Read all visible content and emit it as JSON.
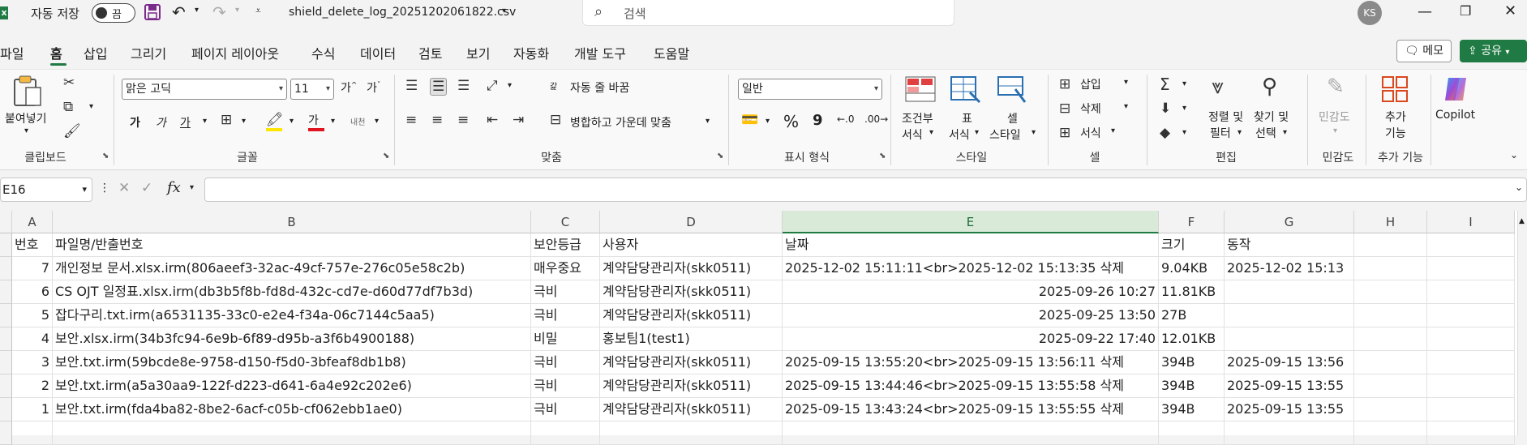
{
  "titlebar": {
    "autosave_label": "자동 저장",
    "autosave_state": "끔",
    "filename": "shield_delete_log_20251202061822.csv",
    "search_placeholder": "검색",
    "avatar": "KS"
  },
  "menu": {
    "tabs": [
      "파일",
      "홈",
      "삽입",
      "그리기",
      "페이지 레이아웃",
      "수식",
      "데이터",
      "검토",
      "보기",
      "자동화",
      "개발 도구",
      "도움말"
    ],
    "memo": "메모",
    "share": "공유"
  },
  "ribbon": {
    "clipboard": {
      "paste": "붙여넣기",
      "label": "클립보드"
    },
    "font": {
      "name": "맑은 고딕",
      "size": "11",
      "label": "글꼴",
      "bold": "가",
      "italic": "가",
      "underline": "가",
      "color_a": "가",
      "phonetic": "내천"
    },
    "align": {
      "wrap": "자동 줄 바꿈",
      "merge": "병합하고 가운데 맞춤",
      "label": "맞춤",
      "wrap_icon": "갍"
    },
    "number": {
      "format": "일반",
      "label": "표시 형식",
      "percent": "%",
      "comma": "9"
    },
    "styles": {
      "cond_l1": "조건부",
      "cond_l2": "서식",
      "table_l1": "표",
      "table_l2": "서식",
      "cell_l1": "셀",
      "cell_l2": "스타일",
      "label": "스타일"
    },
    "cells": {
      "insert": "삽입",
      "delete": "삭제",
      "format": "서식",
      "label": "셀"
    },
    "edit": {
      "sort_l1": "정렬 및",
      "sort_l2": "필터",
      "find_l1": "찾기 및",
      "find_l2": "선택",
      "label": "편집"
    },
    "sensitivity": {
      "btn": "민감도",
      "label": "민감도"
    },
    "addins": {
      "btn_l1": "추가",
      "btn_l2": "기능",
      "label": "추가 기능"
    },
    "copilot": "Copilot"
  },
  "formula_bar": {
    "namebox": "E16",
    "fx": "fx",
    "value": ""
  },
  "columns": [
    "A",
    "B",
    "C",
    "D",
    "E",
    "F",
    "G",
    "H",
    "I"
  ],
  "selected_column": "E",
  "table": {
    "headers": [
      "번호",
      "파일명/반출번호",
      "보안등급",
      "사용자",
      "날짜",
      "크기",
      "동작"
    ],
    "rows": [
      [
        "7",
        "개인정보 문서.xlsx.irm(806aeef3-32ac-49cf-757e-276c05e58c2b)",
        "매우중요",
        "계약담당관리자(skk0511)",
        "2025-12-02 15:11:11<br>2025-12-02 15:13:35 삭제",
        "9.04KB",
        "2025-12-02 15:13"
      ],
      [
        "6",
        "CS OJT 일정표.xlsx.irm(db3b5f8b-fd8d-432c-cd7e-d60d77df7b3d)",
        "극비",
        "계약담당관리자(skk0511)",
        "2025-09-26 10:27",
        "11.81KB",
        ""
      ],
      [
        "5",
        "잡다구리.txt.irm(a6531135-33c0-e2e4-f34a-06c7144c5aa5)",
        "극비",
        "계약담당관리자(skk0511)",
        "2025-09-25 13:50",
        "27B",
        ""
      ],
      [
        "4",
        "보안.xlsx.irm(34b3fc94-6e9b-6f89-d95b-a3f6b4900188)",
        "비밀",
        "홍보팀1(test1)",
        "2025-09-22 17:40",
        "12.01KB",
        ""
      ],
      [
        "3",
        "보안.txt.irm(59bcde8e-9758-d150-f5d0-3bfeaf8db1b8)",
        "극비",
        "계약담당관리자(skk0511)",
        "2025-09-15 13:55:20<br>2025-09-15 13:56:11 삭제",
        "394B",
        "2025-09-15 13:56"
      ],
      [
        "2",
        "보안.txt.irm(a5a30aa9-122f-d223-d641-6a4e92c202e6)",
        "극비",
        "계약담당관리자(skk0511)",
        "2025-09-15 13:44:46<br>2025-09-15 13:55:58 삭제",
        "394B",
        "2025-09-15 13:55"
      ],
      [
        "1",
        "보안.txt.irm(fda4ba82-8be2-6acf-c05b-cf062ebb1ae0)",
        "극비",
        "계약담당관리자(skk0511)",
        "2025-09-15 13:43:24<br>2025-09-15 13:55:55 삭제",
        "394B",
        "2025-09-15 13:55"
      ]
    ]
  },
  "colors": {
    "accent": "#1f7a43",
    "share_bg": "#1f7a43"
  }
}
